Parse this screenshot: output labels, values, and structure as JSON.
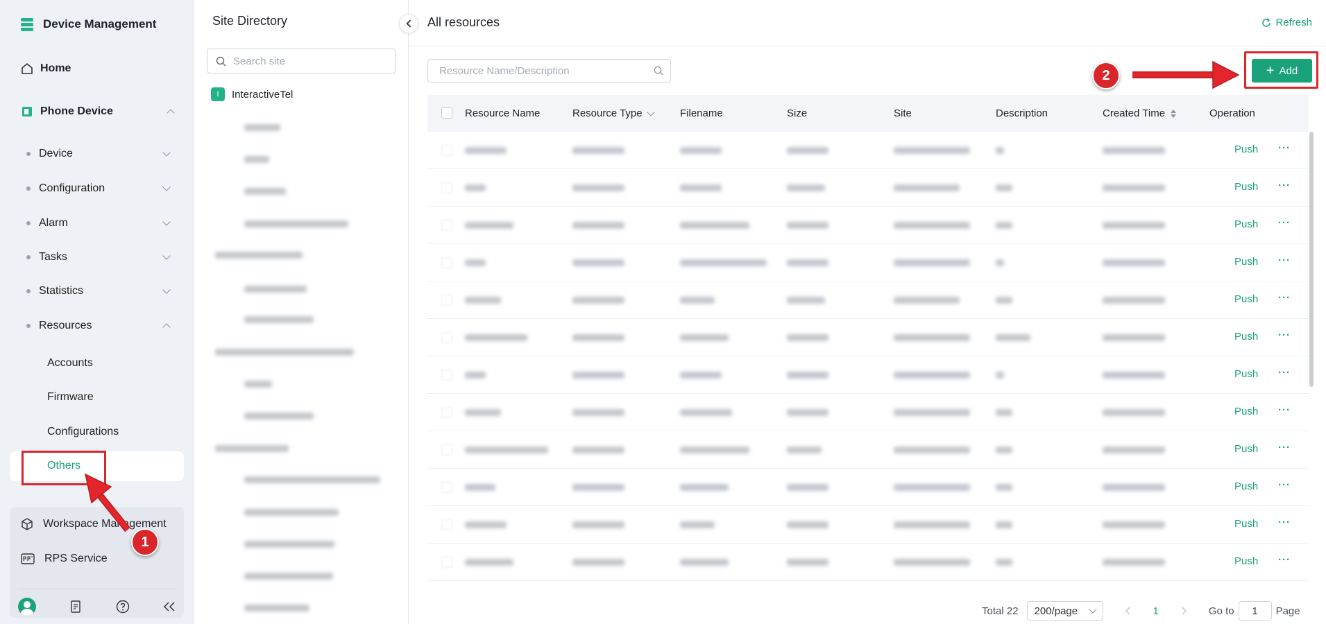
{
  "sidebar": {
    "app_title": "Device Management",
    "home": "Home",
    "phone_device": "Phone Device",
    "submenus": [
      "Device",
      "Configuration",
      "Alarm",
      "Tasks",
      "Statistics",
      "Resources"
    ],
    "resource_items": [
      "Accounts",
      "Firmware",
      "Configurations",
      "Others"
    ],
    "bottom": {
      "workspace": "Workspace Management",
      "rps": "RPS Service"
    },
    "icons": [
      "avatar",
      "report-icon",
      "help-icon",
      "collapse-icon"
    ]
  },
  "directory": {
    "title": "Site Directory",
    "search_placeholder": "Search site",
    "root_initial": "I",
    "root_site": "InteractiveTel"
  },
  "main": {
    "title": "All resources",
    "refresh": "Refresh",
    "search_placeholder": "Resource Name/Description",
    "add": "Add",
    "columns": [
      "Resource Name",
      "Resource Type",
      "Filename",
      "Size",
      "Site",
      "Description",
      "Created Time",
      "Operation"
    ],
    "row_action": "Push",
    "row_more": "···",
    "visible_rows": 12
  },
  "pagination": {
    "total": "Total 22",
    "page_size": "200/page",
    "current_page": "1",
    "goto_label": "Go to",
    "goto_value": "1",
    "page_label": "Page"
  },
  "annotations": {
    "step1": "1",
    "step2": "2"
  },
  "colors": {
    "accent": "#1aa37a",
    "annotation_red": "#d8262b",
    "sidebar_bg": "#eef1f5"
  }
}
